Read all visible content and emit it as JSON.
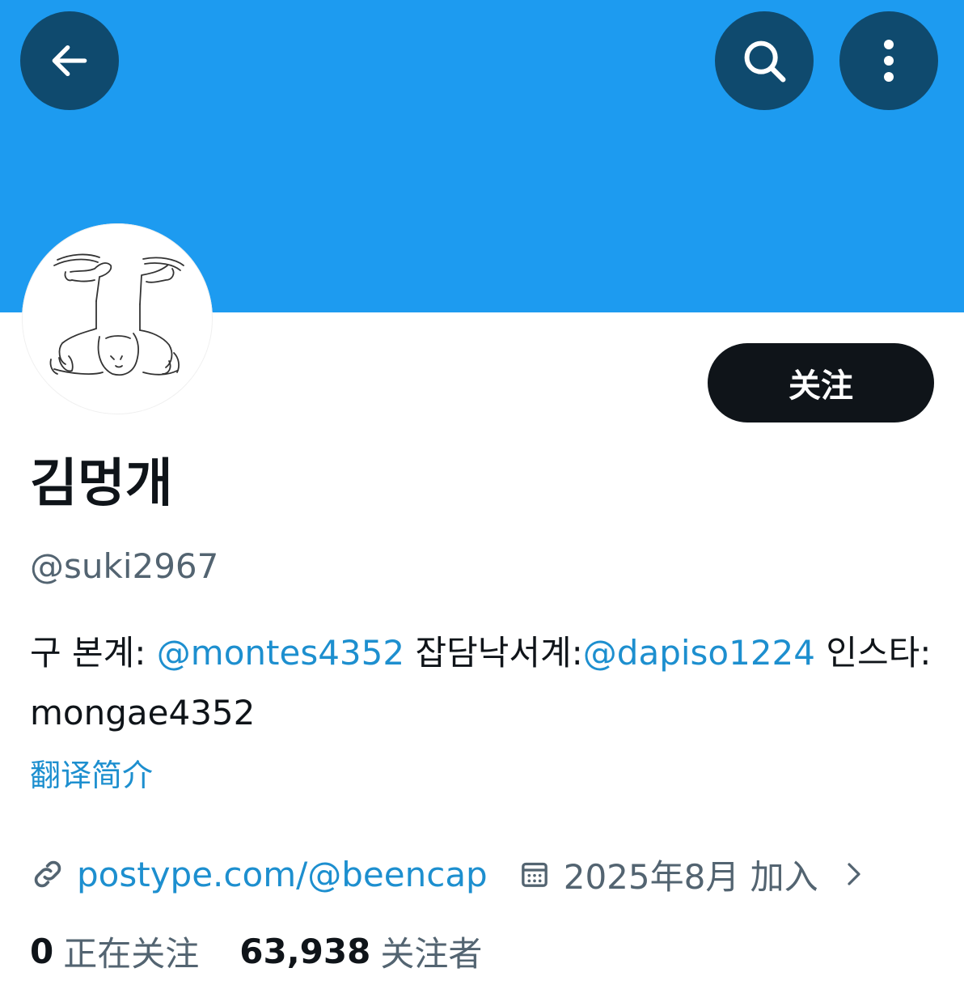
{
  "header": {
    "back_icon": "arrow-left-icon",
    "search_icon": "search-icon",
    "more_icon": "more-vertical-icon",
    "banner_color": "#1d9bf0"
  },
  "profile": {
    "display_name": "김멍개",
    "handle": "@suki2967",
    "follow_label": "关注",
    "bio": {
      "prefix": "구 본계: ",
      "mention1": "@montes4352",
      "middle": "  잡담낙서계:",
      "mention2": "@dapiso1224",
      "suffix": " 인스타: mongae4352"
    },
    "translate_label": "翻译简介",
    "website": "postype.com/@beencap",
    "joined": "2025年8月 加入",
    "following_count": "0",
    "following_label": "正在关注",
    "followers_count": "63,938",
    "followers_label": "关注者"
  },
  "colors": {
    "accent": "#1d9bf0",
    "link": "#1d8fcf",
    "secondary_text": "#536471",
    "primary_text": "#0f1419"
  }
}
